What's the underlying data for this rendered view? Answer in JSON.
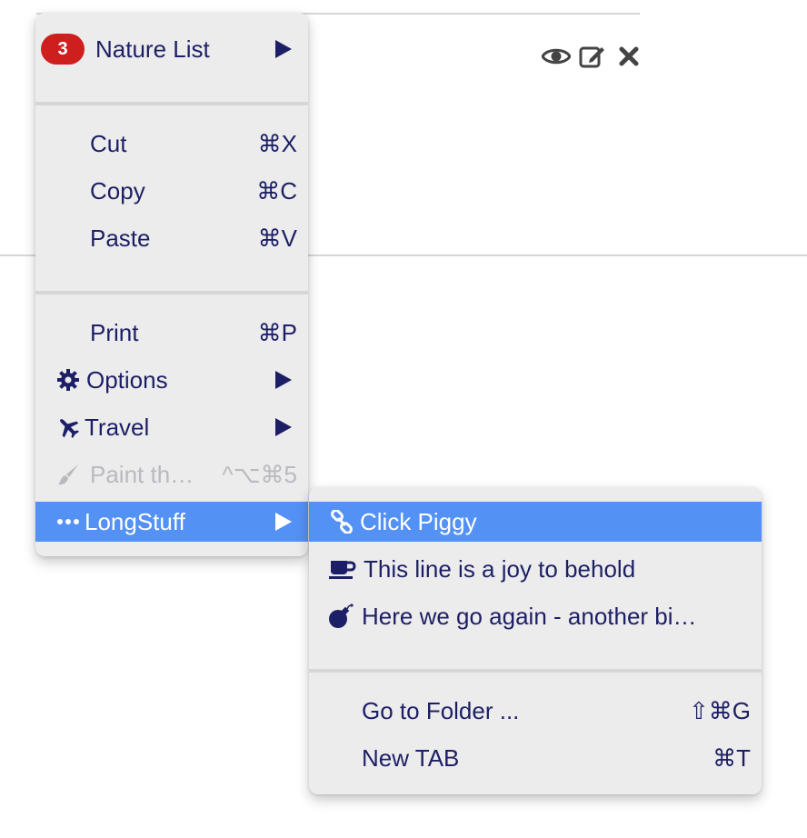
{
  "toolbar": {
    "view_icon": "eye-icon",
    "edit_icon": "edit-icon",
    "close_icon": "close-icon"
  },
  "menu": {
    "nature": {
      "badge": "3",
      "label": "Nature List"
    },
    "cut": {
      "label": "Cut",
      "shortcut": "⌘X"
    },
    "copy": {
      "label": "Copy",
      "shortcut": "⌘C"
    },
    "paste": {
      "label": "Paste",
      "shortcut": "⌘V"
    },
    "print": {
      "label": "Print",
      "shortcut": "⌘P"
    },
    "options": {
      "label": "Options",
      "icon": "gear-icon"
    },
    "travel": {
      "label": "Travel",
      "icon": "airplane-icon"
    },
    "paint": {
      "label": "Paint th…",
      "shortcut": "^⌥⌘5",
      "icon": "brush-icon",
      "disabled": true
    },
    "longstuff": {
      "label": "LongStuff",
      "icon": "ellipsis-icon",
      "active": true
    }
  },
  "submenu": {
    "click_piggy": {
      "label": "Click Piggy",
      "icon": "link-icon",
      "active": true
    },
    "joy": {
      "label": "This line is a joy to behold",
      "icon": "coffee-icon"
    },
    "again": {
      "label": "Here we go again - another bi…",
      "icon": "bomb-icon"
    },
    "folder": {
      "label": "Go to Folder ...",
      "shortcut": "⇧⌘G"
    },
    "newtab": {
      "label": "New TAB",
      "shortcut": "⌘T"
    }
  },
  "colors": {
    "text": "#1d1f66",
    "active_bg": "#5491f5",
    "badge_bg": "#cf1e1e",
    "menu_bg": "#ececec",
    "disabled": "#b9b9bf"
  }
}
